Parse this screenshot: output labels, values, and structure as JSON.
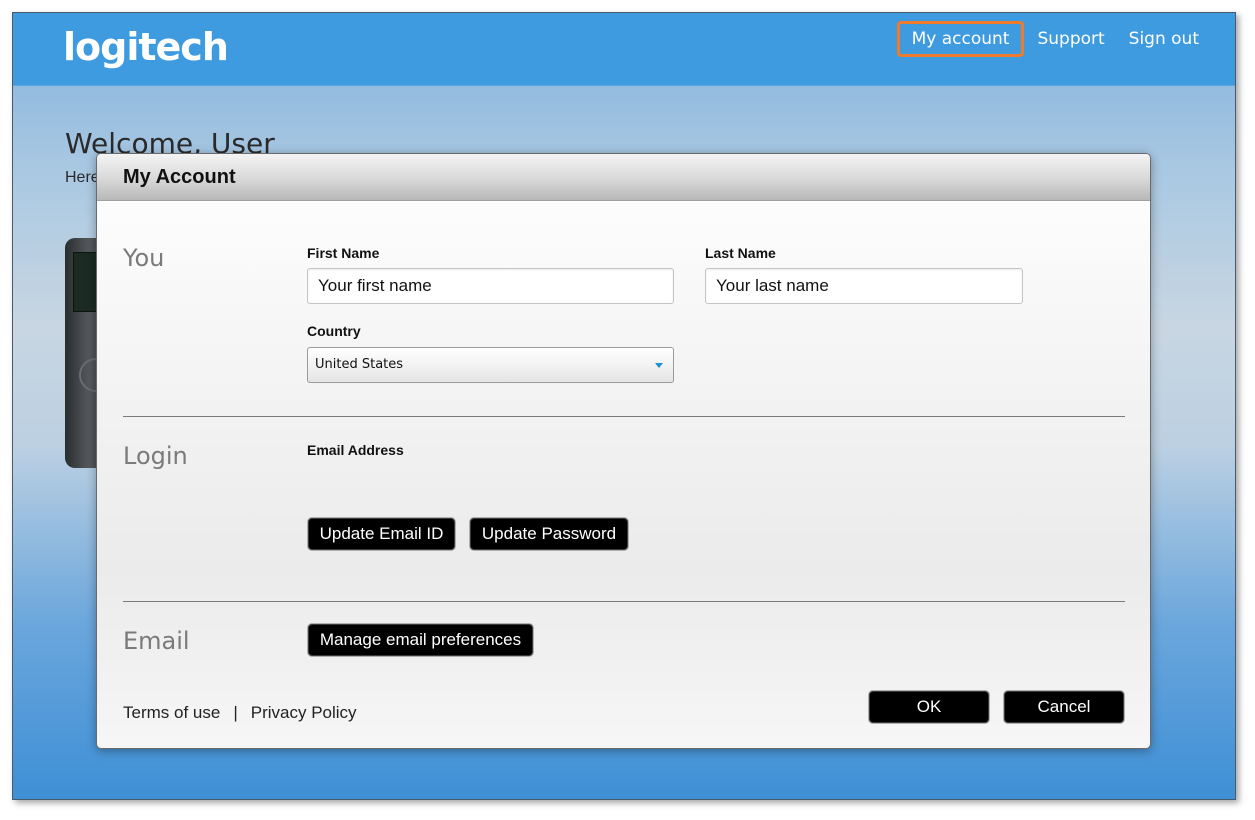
{
  "header": {
    "logo": "logitech",
    "nav": {
      "my_account": "My account",
      "support": "Support",
      "sign_out": "Sign out"
    }
  },
  "background": {
    "welcome": "Welcome, User",
    "subtext": "Here"
  },
  "modal": {
    "title": "My Account",
    "you": {
      "label": "You",
      "first_name_label": "First Name",
      "first_name_placeholder": "Your first name",
      "last_name_label": "Last Name",
      "last_name_placeholder": "Your last name",
      "country_label": "Country",
      "country_value": "United States"
    },
    "login": {
      "label": "Login",
      "email_label": "Email Address",
      "update_email_button": "Update Email ID",
      "update_password_button": "Update Password"
    },
    "email": {
      "label": "Email",
      "manage_prefs_button": "Manage email preferences"
    },
    "footer": {
      "terms": "Terms of use",
      "separator": "|",
      "privacy": "Privacy Policy",
      "ok_button": "OK",
      "cancel_button": "Cancel"
    }
  },
  "colors": {
    "topbar": "#3f9be0",
    "highlight": "#f07a2c",
    "button_bg": "#000000"
  }
}
